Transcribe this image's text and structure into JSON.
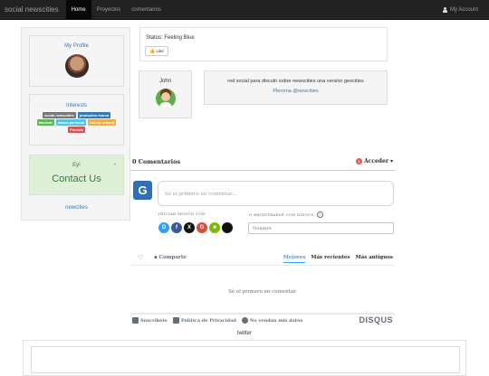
{
  "navbar": {
    "brand": "social newscities",
    "items": [
      {
        "label": "Home",
        "active": true
      },
      {
        "label": "Proyectos",
        "active": false
      },
      {
        "label": "comentarios",
        "active": false
      }
    ],
    "account": "My Account"
  },
  "sidebar": {
    "profile_title": "My Profile",
    "interests_title": "Interests",
    "tags": [
      {
        "label": "social newscities",
        "color": "#777777"
      },
      {
        "label": "productos marca",
        "color": "#337ab7"
      },
      {
        "label": "twoisett",
        "color": "#5cb85c"
      },
      {
        "label": "marca personal",
        "color": "#5bc0de"
      },
      {
        "label": "huerto urbano",
        "color": "#f0ad4e"
      },
      {
        "label": "Friends",
        "color": "#d9534f"
      }
    ],
    "alert_title": "Ey!",
    "alert_close": "×",
    "alert_contact": "Contact Us",
    "link": "newcities"
  },
  "status": {
    "text": "Status: Feeling Blue",
    "like_label": "Like"
  },
  "john": {
    "name": "John"
  },
  "description": {
    "text": "red social para discutir sobre newscities una version geocities",
    "link": "Pleroma @newcities"
  },
  "disqus": {
    "count": "0 Comentarios",
    "login_badge": "1",
    "login_label": "Acceder",
    "comment_placeholder": "Sé el primero en comentar...",
    "login_with": "INICIAR SESIÓN CON",
    "or_register": "O REGISTRARSE CON DISQUS",
    "help": "?",
    "social": [
      {
        "label": "D",
        "color": "#2e9fff"
      },
      {
        "label": "f",
        "color": "#3b5998"
      },
      {
        "label": "X",
        "color": "#111111"
      },
      {
        "label": "G",
        "color": "#dd4b39"
      },
      {
        "label": "■",
        "color": "#7fba00"
      },
      {
        "label": "",
        "color": "#111111"
      }
    ],
    "name_placeholder": "Nombre",
    "share": "Comparte",
    "sorts": [
      "Mejores",
      "Más recientes",
      "Más antiguos"
    ],
    "empty": "Sé el primero en comentar.",
    "footer": [
      "Suscríbete",
      "Política de Privacidad",
      "No vendan mis datos"
    ],
    "brand": "DISQUS"
  },
  "twitter": "twitter"
}
